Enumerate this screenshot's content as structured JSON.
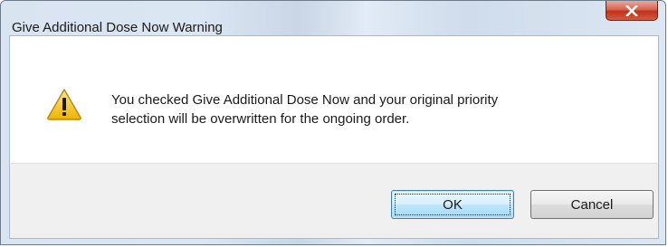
{
  "window": {
    "title": "Give Additional Dose Now Warning",
    "close_icon": "close-x-icon"
  },
  "content": {
    "icon": "warning-icon",
    "message_line1": "You checked Give Additional Dose Now and your original priority",
    "message_line2": "selection will be overwritten for the ongoing order."
  },
  "buttons": {
    "ok_label": "OK",
    "cancel_label": "Cancel"
  },
  "colors": {
    "close_button": "#c7402a",
    "warning_fill": "#f5c518",
    "ok_button_accent": "#3c7fb1"
  }
}
